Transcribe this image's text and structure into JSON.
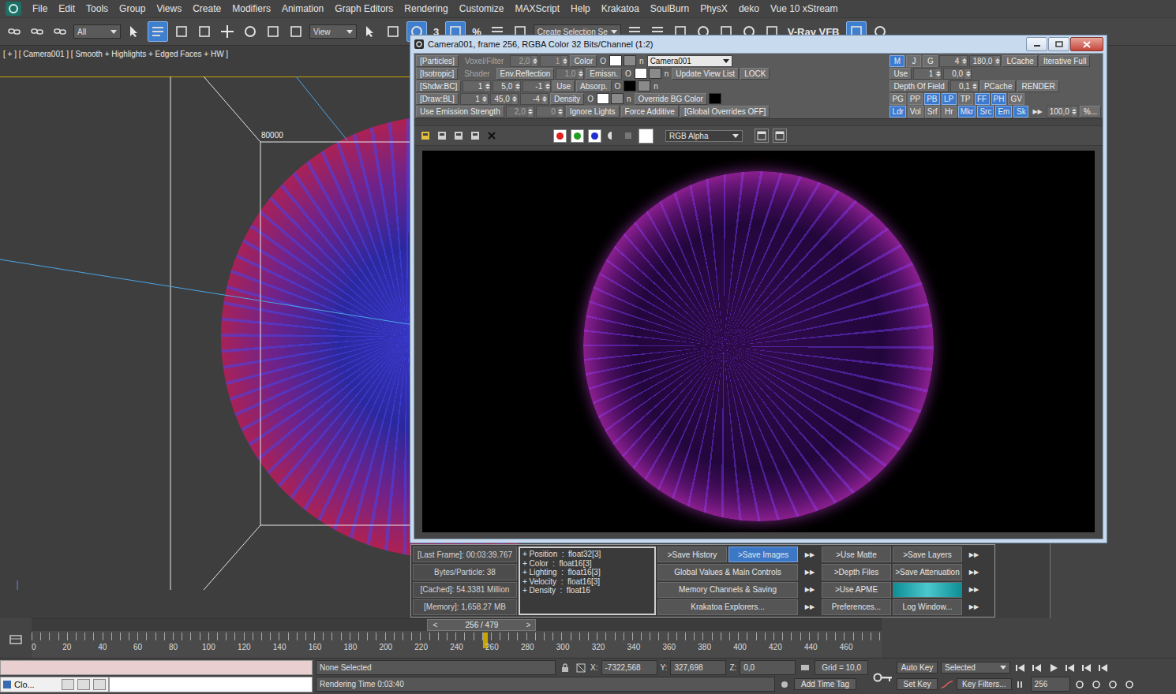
{
  "menu": [
    "File",
    "Edit",
    "Tools",
    "Group",
    "Views",
    "Create",
    "Modifiers",
    "Animation",
    "Graph Editors",
    "Rendering",
    "Customize",
    "MAXScript",
    "Help",
    "Krakatoa",
    "SoulBurn",
    "PhysX",
    "deko",
    "Vue 10 xStream"
  ],
  "toolbar": [
    {
      "kind": "icon",
      "selected": false
    },
    {
      "kind": "icon",
      "selected": false
    },
    {
      "kind": "icon",
      "selected": false
    },
    {
      "kind": "dropdown",
      "label": "All",
      "selected": false
    },
    {
      "kind": "icon",
      "selected": false
    },
    {
      "kind": "icon",
      "selected": true
    },
    {
      "kind": "icon",
      "selected": false
    },
    {
      "kind": "icon",
      "selected": false
    },
    {
      "kind": "icon",
      "selected": false
    },
    {
      "kind": "icon",
      "selected": false
    },
    {
      "kind": "icon",
      "selected": false
    },
    {
      "kind": "icon",
      "selected": false
    },
    {
      "kind": "dropdown",
      "label": "View",
      "selected": false
    },
    {
      "kind": "icon",
      "selected": false
    },
    {
      "kind": "icon",
      "selected": false
    },
    {
      "kind": "icon",
      "selected": true
    },
    {
      "kind": "text",
      "label": "3",
      "selected": false
    },
    {
      "kind": "icon",
      "selected": true
    },
    {
      "kind": "text",
      "label": "%",
      "selected": false
    },
    {
      "kind": "icon",
      "selected": false
    },
    {
      "kind": "icon",
      "selected": false
    },
    {
      "kind": "dropdown",
      "label": "Create Selection Se",
      "selected": false
    },
    {
      "kind": "icon",
      "selected": false
    },
    {
      "kind": "icon",
      "selected": false
    },
    {
      "kind": "icon",
      "selected": false
    },
    {
      "kind": "icon",
      "selected": false
    },
    {
      "kind": "icon",
      "selected": false
    },
    {
      "kind": "icon",
      "selected": false
    },
    {
      "kind": "icon",
      "selected": false
    },
    {
      "kind": "text",
      "label": "V-Ray VFB",
      "selected": false
    },
    {
      "kind": "icon",
      "selected": true
    },
    {
      "kind": "icon",
      "selected": false
    }
  ],
  "viewport": {
    "label": "[ + ] [ Camera001 ] [ Smooth + Highlights + Edged Faces + HW ]",
    "frame_size": "80000"
  },
  "render_window": {
    "title": "Camera001, frame 256, RGBA Color 32 Bits/Channel (1:2)",
    "controls_left": [
      [
        {
          "kind": "btn",
          "label": "[Particles]"
        },
        {
          "kind": "dim",
          "label": "Voxel/Filter"
        },
        {
          "kind": "dimspin",
          "label": "2,0"
        },
        {
          "kind": "dimspin",
          "label": "1"
        },
        {
          "kind": "btn",
          "label": "Color"
        },
        {
          "kind": "lbl",
          "label": "O"
        },
        {
          "kind": "sw",
          "color": "#ffffff"
        },
        {
          "kind": "sw",
          "color": "#8a8a8a"
        },
        {
          "kind": "lbl",
          "label": "n"
        },
        {
          "kind": "dd",
          "label": "Camera001"
        }
      ],
      [
        {
          "kind": "btn",
          "label": "[Isotropic]"
        },
        {
          "kind": "dim",
          "label": "Shader"
        },
        {
          "kind": "btn",
          "label": "Env.Reflection"
        },
        {
          "kind": "dimspin",
          "label": "1,0"
        },
        {
          "kind": "btn",
          "label": "Emissn."
        },
        {
          "kind": "lbl",
          "label": "O"
        },
        {
          "kind": "sw",
          "color": "#ffffff"
        },
        {
          "kind": "sw",
          "color": "#8a8a8a"
        },
        {
          "kind": "lbl",
          "label": "n"
        },
        {
          "kind": "btn",
          "label": "Update View List"
        },
        {
          "kind": "btn",
          "label": "LOCK"
        }
      ],
      [
        {
          "kind": "btn",
          "label": "[Shdw:BC]"
        },
        {
          "kind": "spin",
          "label": "1"
        },
        {
          "kind": "spin",
          "label": "5,0"
        },
        {
          "kind": "spin",
          "label": "-1"
        },
        {
          "kind": "btn",
          "label": "Use"
        },
        {
          "kind": "btn",
          "label": "Absorp."
        },
        {
          "kind": "lbl",
          "label": "O"
        },
        {
          "kind": "sw",
          "color": "#000000"
        },
        {
          "kind": "sw",
          "color": "#8a8a8a"
        },
        {
          "kind": "lbl",
          "label": "n"
        }
      ],
      [
        {
          "kind": "btn",
          "label": "[Draw:BL]"
        },
        {
          "kind": "spin",
          "label": "1"
        },
        {
          "kind": "spin",
          "label": "45,0"
        },
        {
          "kind": "spin",
          "label": "-4"
        },
        {
          "kind": "btn",
          "label": "Density"
        },
        {
          "kind": "lbl",
          "label": "O"
        },
        {
          "kind": "sw",
          "color": "#ffffff"
        },
        {
          "kind": "sw",
          "color": "#8a8a8a"
        },
        {
          "kind": "lbl",
          "label": "n"
        },
        {
          "kind": "btn",
          "label": "Override BG Color"
        },
        {
          "kind": "sw",
          "color": "#000000"
        }
      ],
      [
        {
          "kind": "btn",
          "label": "Use Emission Strength"
        },
        {
          "kind": "dimspin",
          "label": "2,0"
        },
        {
          "kind": "dimspin",
          "label": "0"
        },
        {
          "kind": "btn",
          "label": "Ignore Lights"
        },
        {
          "kind": "btn",
          "label": "Force Additive"
        },
        {
          "kind": "btn",
          "label": "[Global Overrides OFF]"
        }
      ]
    ],
    "controls_right": [
      [
        {
          "kind": "tog",
          "label": "M",
          "selected": true
        },
        {
          "kind": "tog",
          "label": "J",
          "selected": false
        },
        {
          "kind": "tog",
          "label": "G",
          "selected": false
        },
        {
          "kind": "spin",
          "label": "4"
        },
        {
          "kind": "spin",
          "label": "180,0"
        },
        {
          "kind": "btn",
          "label": "LCache"
        },
        {
          "kind": "btn",
          "label": "Iterative Full"
        }
      ],
      [
        {
          "kind": "btn",
          "label": "Use"
        },
        {
          "kind": "spin",
          "label": "1"
        },
        {
          "kind": "spin",
          "label": "0,0"
        }
      ],
      [
        {
          "kind": "btn",
          "label": "Depth Of Field"
        },
        {
          "kind": "spin",
          "label": "0,1"
        },
        {
          "kind": "btn",
          "label": "PCache"
        },
        {
          "kind": "btn",
          "label": "RENDER"
        }
      ],
      [
        {
          "kind": "tog",
          "label": "PG",
          "selected": false
        },
        {
          "kind": "tog",
          "label": "PP",
          "selected": false
        },
        {
          "kind": "tog",
          "label": "PB",
          "selected": true
        },
        {
          "kind": "tog",
          "label": "LP",
          "selected": true
        },
        {
          "kind": "tog",
          "label": "TP",
          "selected": false
        },
        {
          "kind": "tog",
          "label": "FF",
          "selected": true
        },
        {
          "kind": "tog",
          "label": "PH",
          "selected": true
        },
        {
          "kind": "tog",
          "label": "GV",
          "selected": false
        }
      ],
      [
        {
          "kind": "tog",
          "label": "Ldr",
          "selected": true
        },
        {
          "kind": "tog",
          "label": "Vol",
          "selected": false
        },
        {
          "kind": "tog",
          "label": "Srf",
          "selected": false
        },
        {
          "kind": "tog",
          "label": "Hr",
          "selected": false
        },
        {
          "kind": "tog",
          "label": "Mkr",
          "selected": true
        },
        {
          "kind": "tog",
          "label": "Src",
          "selected": true
        },
        {
          "kind": "tog",
          "label": "Em",
          "selected": true
        },
        {
          "kind": "tog",
          "label": "Sk",
          "selected": true
        },
        {
          "kind": "arrow",
          "label": "▶▶"
        },
        {
          "kind": "spin",
          "label": "100,0"
        },
        {
          "kind": "btn",
          "label": "%..."
        }
      ]
    ],
    "toolbar": {
      "channels": [
        {
          "color": "#e02020",
          "selected": true
        },
        {
          "color": "#20a020",
          "selected": true
        },
        {
          "color": "#2030d0",
          "selected": true
        }
      ],
      "swatch": "#ffffff",
      "display": "RGB Alpha"
    }
  },
  "krakatoa_panel": {
    "stats": [
      "[Last Frame]: 00:03:39.767",
      "Bytes/Particle: 38",
      "[Cached]: 54.3381 Million",
      "[Memory]: 1,658.27 MB"
    ],
    "channels": [
      "+ Position  :  float32[3]",
      "+ Color  :  float16[3]",
      "+ Lighting  :  float16[3]",
      "+ Velocity  :  float16[3]",
      "+ Density  :  float16"
    ],
    "buttons": [
      [
        {
          "kind": "btn",
          "label": ">Save History",
          "selected": false
        },
        {
          "kind": "btn",
          "label": ">Save Images",
          "selected": true
        },
        {
          "kind": "arrow",
          "label": "▶▶",
          "selected": false
        },
        {
          "kind": "btn",
          "label": ">Use Matte",
          "selected": false
        },
        {
          "kind": "btn",
          "label": ">Save Layers",
          "selected": false
        },
        {
          "kind": "arrow",
          "label": "▶▶",
          "selected": false
        }
      ],
      [
        {
          "kind": "wide",
          "label": "Global Values & Main Controls",
          "selected": false
        },
        {
          "kind": "arrow",
          "label": "▶▶",
          "selected": false
        },
        {
          "kind": "btn",
          "label": ">Depth Files",
          "selected": false
        },
        {
          "kind": "btn",
          "label": ">Save Attenuation",
          "selected": false
        },
        {
          "kind": "arrow",
          "label": "▶▶",
          "selected": false
        }
      ],
      [
        {
          "kind": "wide",
          "label": "Memory Channels & Saving",
          "selected": false
        },
        {
          "kind": "arrow",
          "label": "▶▶",
          "selected": false
        },
        {
          "kind": "btn",
          "label": ">Use APME",
          "selected": false
        },
        {
          "kind": "bar",
          "level": 1.0,
          "selected": false
        },
        {
          "kind": "arrow",
          "label": "▶▶",
          "selected": false
        }
      ],
      [
        {
          "kind": "wide",
          "label": "Krakatoa Explorers...",
          "selected": false
        },
        {
          "kind": "arrow",
          "label": "▶▶",
          "selected": false
        },
        {
          "kind": "btn",
          "label": "Preferences...",
          "selected": false
        },
        {
          "kind": "btn",
          "label": "Log Window...",
          "selected": false
        },
        {
          "kind": "arrow",
          "label": "▶▶",
          "selected": false
        }
      ]
    ]
  },
  "time_slider": {
    "prev": "<",
    "label": "256 / 479",
    "next": ">",
    "level": 0.534
  },
  "timeline": {
    "ticks": [
      "0",
      "20",
      "40",
      "60",
      "80",
      "100",
      "120",
      "140",
      "160",
      "180",
      "200",
      "220",
      "240",
      "260",
      "280",
      "300",
      "320",
      "340",
      "360",
      "380",
      "400",
      "420",
      "440",
      "460"
    ]
  },
  "status": {
    "mini_tab": "Clo...",
    "selection": "None Selected",
    "prompt": "Rendering Time  0:03:40",
    "x_label": "X:",
    "x": "-7322,568",
    "y_label": "Y:",
    "y": "327,698",
    "z_label": "Z:",
    "z": "0,0",
    "grid": "Grid = 10,0",
    "time_tag": "Add Time Tag",
    "auto_key": "Auto Key",
    "key_mode": "Selected",
    "set_key": "Set Key",
    "key_filters": "Key Filters...",
    "frame": "256"
  }
}
